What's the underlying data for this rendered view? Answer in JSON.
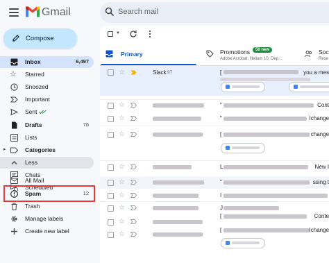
{
  "app": {
    "brand": "Gmail"
  },
  "search": {
    "placeholder": "Search mail"
  },
  "compose": {
    "label": "Compose"
  },
  "sidebar": {
    "items": [
      {
        "label": "Inbox",
        "count": "6,497",
        "icon": "inbox-icon"
      },
      {
        "label": "Starred",
        "icon": "star-icon"
      },
      {
        "label": "Snoozed",
        "icon": "clock-icon"
      },
      {
        "label": "Important",
        "icon": "important-icon"
      },
      {
        "label": "Sent",
        "icon": "send-icon"
      },
      {
        "label": "Drafts",
        "count": "76",
        "icon": "draft-icon"
      },
      {
        "label": "Lists",
        "icon": "list-icon"
      },
      {
        "label": "Categories",
        "icon": "label-icon"
      },
      {
        "label": "Less",
        "icon": "chevron-up-icon"
      },
      {
        "label": "Chats",
        "icon": "chat-icon"
      },
      {
        "label": "Scheduled",
        "icon": "scheduled-icon"
      },
      {
        "label": "All Mail",
        "icon": "mail-icon"
      },
      {
        "label": "Spam",
        "count": "12",
        "icon": "spam-icon"
      },
      {
        "label": "Trash",
        "icon": "trash-icon"
      },
      {
        "label": "Manage labels",
        "icon": "settings-icon"
      },
      {
        "label": "Create new label",
        "icon": "plus-icon"
      }
    ]
  },
  "tabs": {
    "primary": {
      "label": "Primary"
    },
    "promotions": {
      "label": "Promotions",
      "badge": "50 new",
      "sub": "Adobe Acrobat, Helium 10, Dep..."
    },
    "social": {
      "label": "Soc",
      "sub": "Rese"
    }
  },
  "emails": [
    {
      "sender": "Slack",
      "count": "97",
      "subject": "[",
      "suffix": "you a mes"
    },
    {
      "subject": "\"",
      "suffix": "Cont"
    },
    {
      "subject": "\"",
      "suffix": "Ichange"
    },
    {
      "subject": "[",
      "suffix": "change"
    },
    {
      "subject": "L",
      "suffix": "New I"
    },
    {
      "subject": "\"",
      "suffix": "ssing t"
    },
    {
      "subject": "I",
      "suffix": ""
    },
    {
      "subject": "J",
      "suffix": ""
    },
    {
      "subject": "[",
      "suffix": "Conte"
    },
    {
      "subject": "[",
      "suffix": "Ichange"
    }
  ]
}
